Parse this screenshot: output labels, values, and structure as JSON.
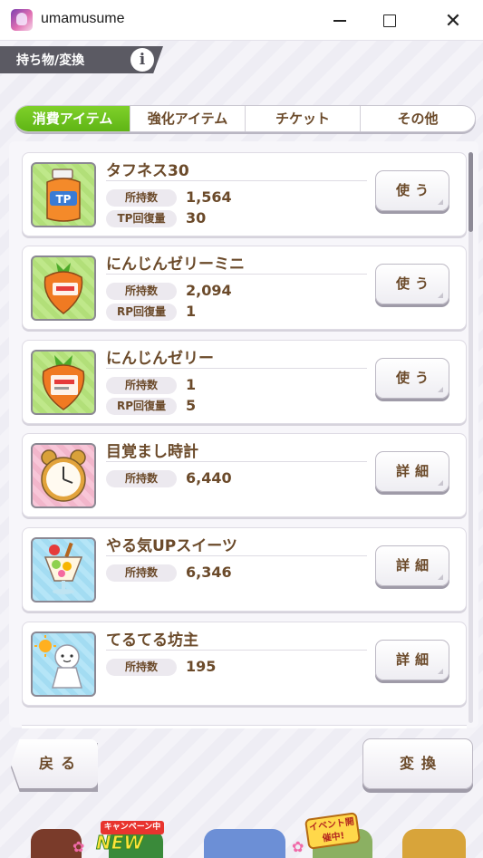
{
  "window": {
    "title": "umamusume"
  },
  "header": {
    "title": "持ち物/変換",
    "info_label": "i"
  },
  "tabs": [
    {
      "label": "消費アイテム",
      "active": true
    },
    {
      "label": "強化アイテム",
      "active": false
    },
    {
      "label": "チケット",
      "active": false
    },
    {
      "label": "その他",
      "active": false
    }
  ],
  "items": [
    {
      "name": "タフネス30",
      "icon": "tp-bottle-icon",
      "stats": [
        {
          "label": "所持数",
          "value": "1,564"
        },
        {
          "label": "TP回復量",
          "value": "30"
        }
      ],
      "action": "使う"
    },
    {
      "name": "にんじんゼリーミニ",
      "icon": "carrot-jelly-mini-icon",
      "stats": [
        {
          "label": "所持数",
          "value": "2,094"
        },
        {
          "label": "RP回復量",
          "value": "1"
        }
      ],
      "action": "使う"
    },
    {
      "name": "にんじんゼリー",
      "icon": "carrot-jelly-icon",
      "stats": [
        {
          "label": "所持数",
          "value": "1"
        },
        {
          "label": "RP回復量",
          "value": "5"
        }
      ],
      "action": "使う"
    },
    {
      "name": "目覚まし時計",
      "icon": "alarm-clock-icon",
      "stats": [
        {
          "label": "所持数",
          "value": "6,440"
        }
      ],
      "action": "詳細"
    },
    {
      "name": "やる気UPスイーツ",
      "icon": "parfait-icon",
      "stats": [
        {
          "label": "所持数",
          "value": "6,346"
        }
      ],
      "action": "詳細"
    },
    {
      "name": "てるてる坊主",
      "icon": "teru-teru-bozu-icon",
      "stats": [
        {
          "label": "所持数",
          "value": "195"
        }
      ],
      "action": "詳細"
    }
  ],
  "footer": {
    "back_label": "戻る",
    "convert_label": "変換"
  },
  "nav": {
    "campaign_badge": "キャンペーン中",
    "new_badge": "NEW",
    "event_badge": "イベント開催中!"
  },
  "colors": {
    "accent_green": "#6cc21e",
    "text_brown": "#6b4a2a"
  }
}
